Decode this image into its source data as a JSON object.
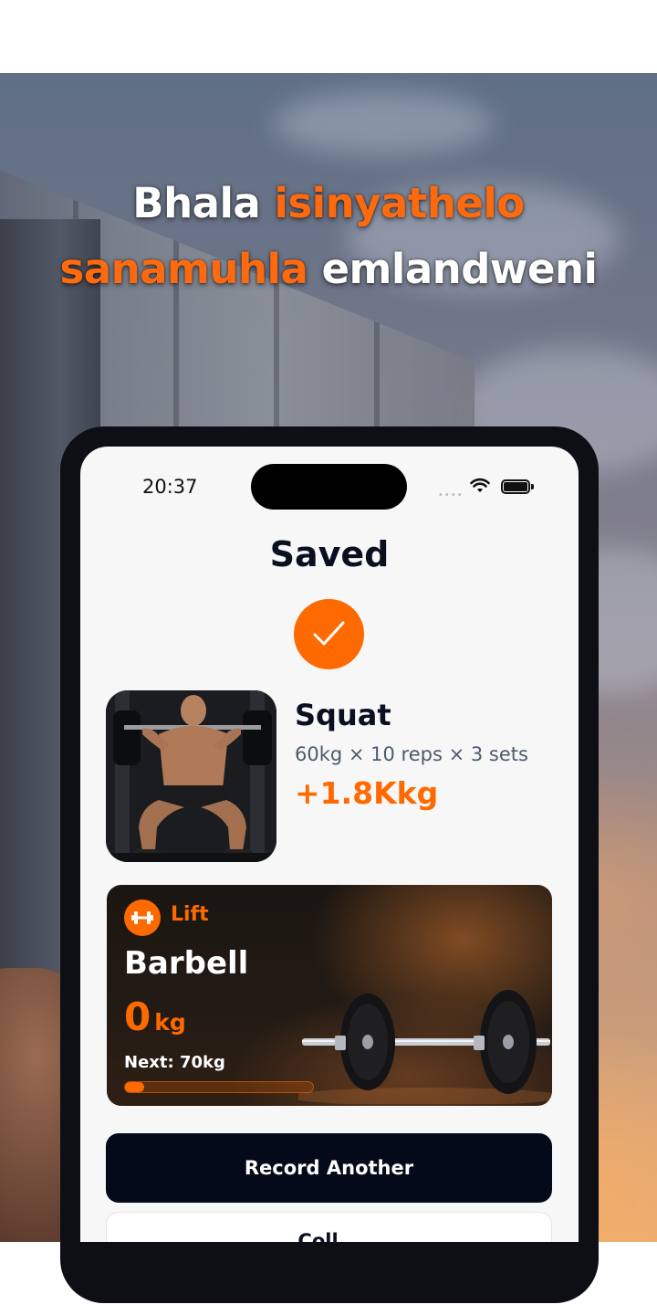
{
  "headline": {
    "line1_plain": "Bhala ",
    "line1_highlight": "isinyathelo",
    "line2_highlight": "sanamuhla",
    "line2_plain": " emlandweni"
  },
  "status_bar": {
    "time": "20:37",
    "signal_dots": "••••",
    "icons": [
      "wifi-icon",
      "battery-icon"
    ]
  },
  "screen": {
    "title": "Saved",
    "check_icon": "checkmark-icon"
  },
  "exercise": {
    "name": "Squat",
    "detail": "60kg × 10 reps × 3 sets",
    "gain": "+1.8Kkg",
    "photo": "man-squatting-with-barbell"
  },
  "lift_card": {
    "icon": "dumbbell-icon",
    "tag": "Lift",
    "name": "Barbell",
    "value": "0",
    "unit": "kg",
    "next": "Next: 70kg",
    "progress_fraction": 0.1
  },
  "actions": {
    "primary_label": "Record Another",
    "secondary_label": "Coll..."
  },
  "colors": {
    "accent": "#ff6a00",
    "primary_button": "#050a1a",
    "title_text": "#0b1020",
    "detail_text": "#4e5a6d"
  }
}
